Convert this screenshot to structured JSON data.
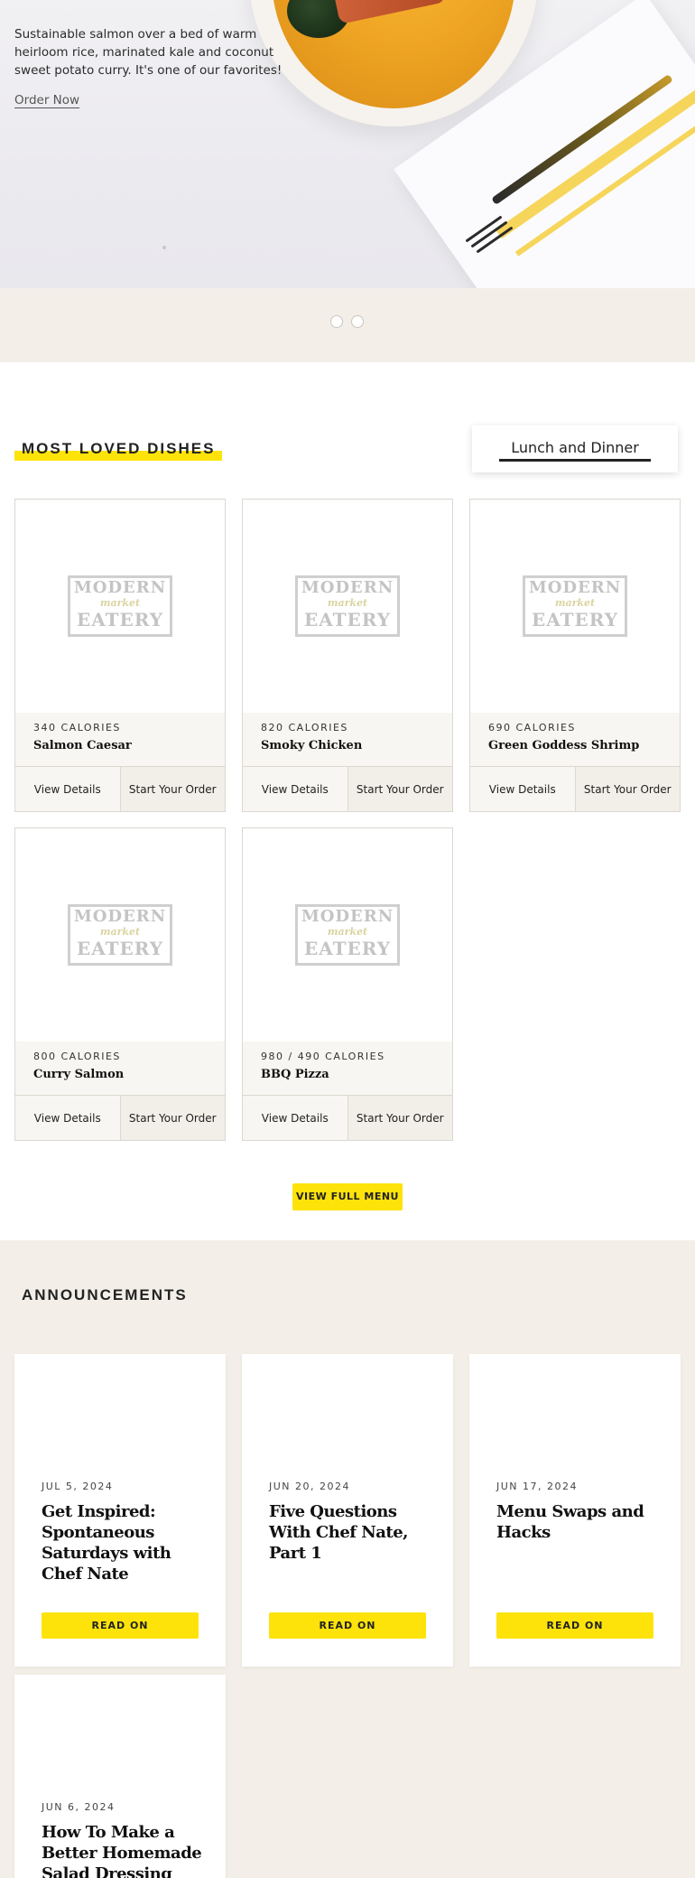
{
  "hero": {
    "description": "Sustainable salmon over a bed of warm heirloom rice, marinated kale and coconut sweet potato curry. It's one of our favorites!",
    "cta": "Order Now"
  },
  "carousel": {
    "slides": 2,
    "active": 1
  },
  "dishes_section": {
    "title": "MOST LOVED DISHES",
    "meal_tab": "Lunch and Dinner",
    "logo": {
      "line1": "MODERN",
      "line2": "market",
      "line3": "EATERY"
    },
    "view_details": "View Details",
    "start_order": "Start Your Order",
    "items": [
      {
        "calories": "340 CALORIES",
        "name": "Salmon Caesar"
      },
      {
        "calories": "820 CALORIES",
        "name": "Smoky Chicken"
      },
      {
        "calories": "690 CALORIES",
        "name": "Green Goddess Shrimp"
      },
      {
        "calories": "800 CALORIES",
        "name": "Curry Salmon"
      },
      {
        "calories": "980 / 490 CALORIES",
        "name": "BBQ Pizza"
      }
    ],
    "view_full_menu": "VIEW FULL MENU"
  },
  "announcements": {
    "title": "ANNOUNCEMENTS",
    "read_on": "READ ON",
    "items": [
      {
        "date": "JUL 5, 2024",
        "title": "Get Inspired: Spontaneous Saturdays with Chef Nate"
      },
      {
        "date": "JUN 20, 2024",
        "title": "Five Questions With Chef Nate, Part 1"
      },
      {
        "date": "JUN 17, 2024",
        "title": "Menu Swaps and Hacks"
      },
      {
        "date": "JUN 6, 2024",
        "title": "How To Make a Better Homemade Salad Dressing"
      }
    ]
  },
  "colors": {
    "accent": "#fde30a",
    "beige": "#f3efe8",
    "card_border": "#dcd8d1"
  }
}
